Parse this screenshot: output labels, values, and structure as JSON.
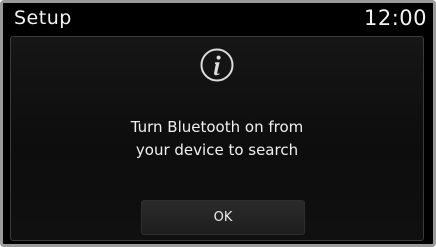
{
  "screen": {
    "title": "Setup",
    "time": "12:00"
  },
  "dialog": {
    "icon": "info-icon",
    "message_line1": "Turn Bluetooth on from",
    "message_line2": "your device to search",
    "ok_label": "OK"
  },
  "colors": {
    "background": "#000000",
    "text": "#f2f2f2",
    "button": "#252525",
    "bezel": "#9a9a9a"
  }
}
